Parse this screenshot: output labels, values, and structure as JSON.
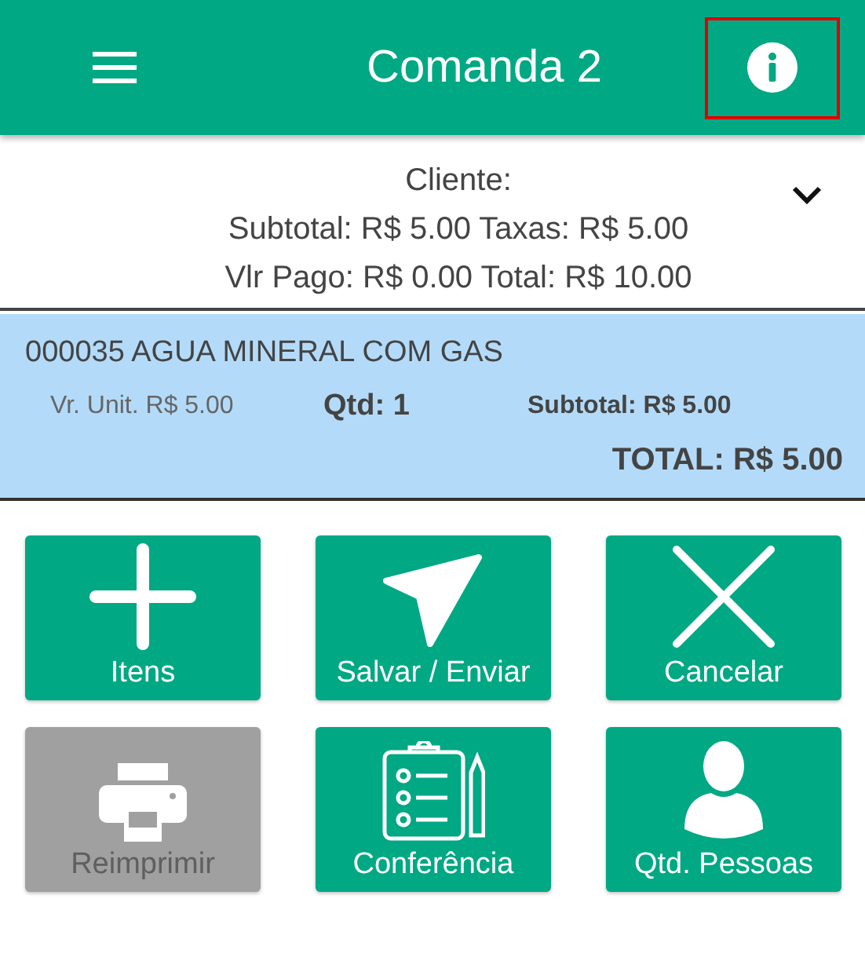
{
  "header": {
    "title": "Comanda 2",
    "info_highlighted": true
  },
  "summary": {
    "expanded": false,
    "lines": [
      "Cliente:",
      "Subtotal: R$ 5.00 Taxas: R$ 5.00",
      "Vlr Pago: R$ 0.00 Total: R$ 10.00"
    ]
  },
  "items": [
    {
      "name": "000035 AGUA MINERAL COM GAS",
      "unit_price": "Vr. Unit. R$ 5.00",
      "quantity": "Qtd: 1",
      "subtotal": "Subtotal: R$ 5.00",
      "total": "TOTAL: R$ 5.00",
      "selected": true
    }
  ],
  "actions": [
    {
      "kind": "plus",
      "label": "Itens",
      "disabled": false
    },
    {
      "kind": "send",
      "label": "Salvar / Enviar",
      "disabled": false
    },
    {
      "kind": "cross",
      "label": "Cancelar",
      "disabled": false
    },
    {
      "kind": "printer",
      "label": "Reimprimir",
      "disabled": true
    },
    {
      "kind": "checklist",
      "label": "Conferência",
      "disabled": false
    },
    {
      "kind": "person",
      "label": "Qtd. Pessoas",
      "disabled": false
    }
  ]
}
